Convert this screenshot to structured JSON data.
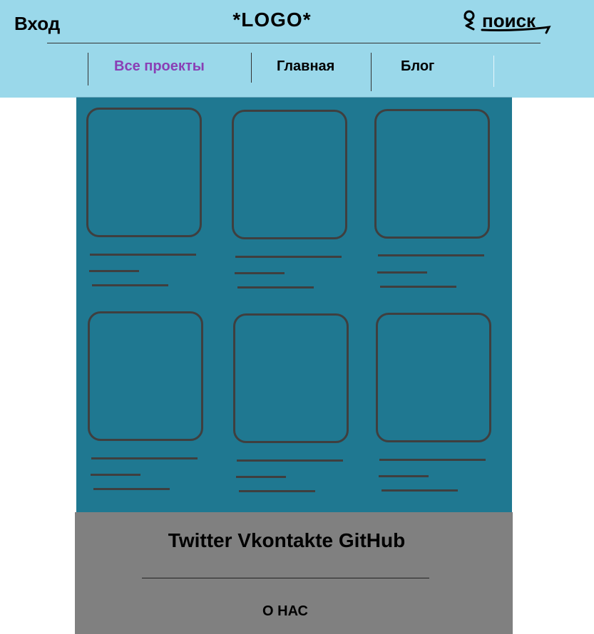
{
  "header": {
    "login_label": "Вход",
    "logo_text": "*LOGO*",
    "search_label": "поиск"
  },
  "nav": {
    "items": [
      {
        "label": "Все проекты",
        "active": true
      },
      {
        "label": "Главная",
        "active": false
      },
      {
        "label": "Блог",
        "active": false
      }
    ]
  },
  "projects": {
    "card_count": 6
  },
  "footer": {
    "social": [
      "Twitter",
      "Vkontakte",
      "GitHub"
    ],
    "about_label": "О НАС"
  },
  "colors": {
    "header_bg": "#9ad8ea",
    "main_bg": "#1f7891",
    "footer_bg": "#808080",
    "active_nav": "#8a3fb5",
    "card_border": "#3f3f3f"
  }
}
